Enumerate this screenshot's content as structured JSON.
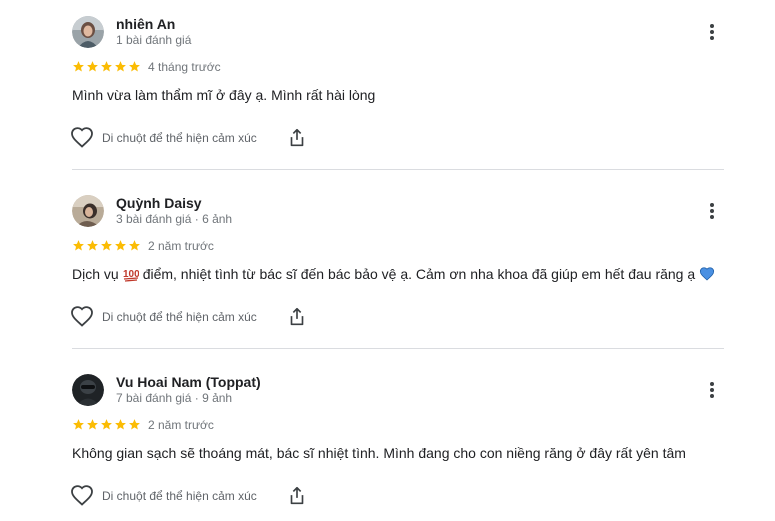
{
  "reviews": [
    {
      "name": "nhiên An",
      "meta": "1 bài đánh giá",
      "rating": 5,
      "when": "4 tháng trước",
      "text_parts": [
        "Mình vừa làm thẩm mĩ ở đây ạ. Mình rất hài lòng"
      ],
      "react_label": "Di chuột để thể hiện cảm xúc"
    },
    {
      "name": "Quỳnh Daisy",
      "meta": "3 bài đánh giá · 6 ảnh",
      "rating": 5,
      "when": "2 năm trước",
      "text_parts": [
        "Dịch vụ",
        "điểm, nhiệt tình từ bác sĩ đến bác bảo vệ ạ. Cảm ơn nha khoa đã giúp em hết đau răng ạ"
      ],
      "react_label": "Di chuột để thể hiện cảm xúc"
    },
    {
      "name": "Vu Hoai Nam (Toppat)",
      "meta": "7 bài đánh giá · 9 ảnh",
      "rating": 5,
      "when": "2 năm trước",
      "text_parts": [
        "Không gian sạch sẽ thoáng mát, bác sĩ nhiệt tình. Mình đang cho con niềng răng ở đây rất yên tâm"
      ],
      "react_label": "Di chuột để thể hiện cảm xúc"
    }
  ],
  "icons": {
    "star": "star-icon",
    "more": "more-vert-icon",
    "like": "heart-outline-icon",
    "share": "share-icon",
    "emoji_100": "hundred-points-emoji",
    "emoji_heart": "blue-heart-emoji"
  },
  "colors": {
    "star": "#fbbc04",
    "text": "#202124",
    "muted": "#70757a",
    "divider": "#dadce0",
    "blue_heart": "#4a90e2",
    "hundred": "#c0392b"
  }
}
